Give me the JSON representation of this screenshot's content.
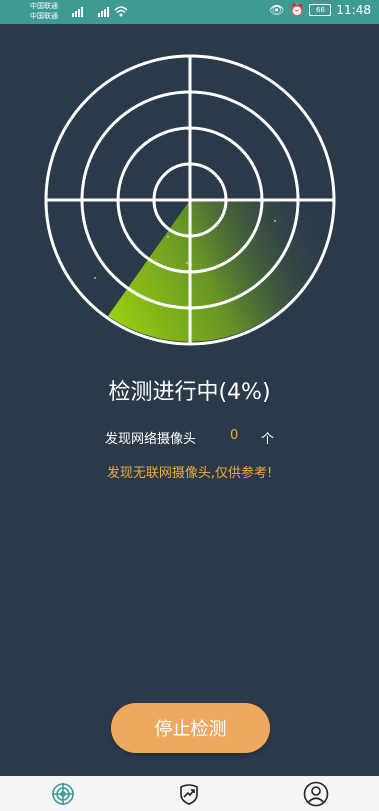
{
  "status_bar": {
    "carrier_1": "中国联通",
    "carrier_2": "中国联通",
    "signal_1": "4G",
    "signal_2": "4G",
    "battery": "66",
    "time": "11:48"
  },
  "scan": {
    "title": "检测进行中(4%)",
    "progress": 0.04,
    "found_label": "发现网络摄像头",
    "found_count": "0",
    "found_unit": "个",
    "notice": "发现无联网摄像头,仅供参考!"
  },
  "actions": {
    "stop_label": "停止检测"
  },
  "bottom_nav": {
    "items": [
      {
        "icon": "radar-scan-icon",
        "active": true
      },
      {
        "icon": "shield-trend-icon",
        "active": false
      },
      {
        "icon": "user-profile-icon",
        "active": false
      }
    ]
  },
  "colors": {
    "background": "#2b3a4b",
    "status_bar": "#3e9b94",
    "accent_orange": "#f0a93b",
    "button": "#eea85e",
    "sweep_green": "#7fb51e"
  }
}
